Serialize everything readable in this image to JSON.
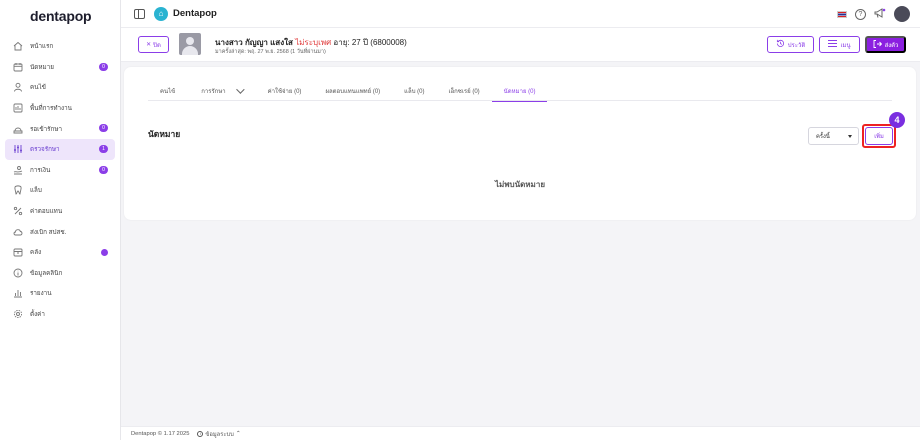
{
  "app": {
    "logo": "dentapop",
    "brand_name": "Dentapop"
  },
  "sidebar": {
    "items": [
      {
        "label": "หน้าแรก",
        "icon": "home-icon",
        "badge": ""
      },
      {
        "label": "นัดหมาย",
        "icon": "calendar-icon",
        "badge": "0"
      },
      {
        "label": "คนไข้",
        "icon": "user-icon",
        "badge": ""
      },
      {
        "label": "พื้นที่การทำงาน",
        "icon": "workspace-icon",
        "badge": ""
      },
      {
        "label": "รอเข้ารักษา",
        "icon": "waiting-icon",
        "badge": "0"
      },
      {
        "label": "ตรวจรักษา",
        "icon": "treatment-icon",
        "badge": "1"
      },
      {
        "label": "การเงิน",
        "icon": "finance-icon",
        "badge": "0"
      },
      {
        "label": "แล็บ",
        "icon": "tooth-icon",
        "badge": ""
      },
      {
        "label": "ค่าตอบแทน",
        "icon": "percent-icon",
        "badge": ""
      },
      {
        "label": "ส่งเบิก สปสช.",
        "icon": "cloud-icon",
        "badge": ""
      },
      {
        "label": "คลัง",
        "icon": "inventory-icon",
        "badge": "dot"
      },
      {
        "label": "ข้อมูลคลินิก",
        "icon": "info-icon",
        "badge": ""
      },
      {
        "label": "รายงาน",
        "icon": "report-icon",
        "badge": ""
      },
      {
        "label": "ตั้งค่า",
        "icon": "gear-icon",
        "badge": ""
      }
    ]
  },
  "patient": {
    "close_label": "ปิด",
    "name": "นางสาว กัญญา แสงใส",
    "gender": "ไม่ระบุเพศ",
    "age_text": "อายุ: 27 ปี",
    "hn": "(6800008)",
    "last_visit": "มาครั้งล่าสุด: พฤ. 27 พ.ย. 2568 (1 วันที่ผ่านมา)",
    "history_label": "ประวัติ",
    "menu_label": "เมนู",
    "send_label": "ส่งตัว"
  },
  "tabs": [
    {
      "label": "คนไข้"
    },
    {
      "label": "การรักษา"
    },
    {
      "label": "ค่าใช้จ่าย (0)"
    },
    {
      "label": "ผลตอบแทนแพทย์ (0)"
    },
    {
      "label": "แล็บ (0)"
    },
    {
      "label": "เอ็กซเรย์ (0)"
    },
    {
      "label": "นัดหมาย (0)"
    }
  ],
  "appointments": {
    "title": "นัดหมาย",
    "filter_value": "ครั้งนี้",
    "add_label": "เพิ่ม",
    "step_number": "4",
    "empty_text": "ไม่พบนัดหมาย"
  },
  "footer": {
    "copyright": "Dentapop © 1.17 2025",
    "info_label": "ข้อมูลระบบ"
  },
  "colors": {
    "accent": "#8b3ee8",
    "highlight": "#e22222",
    "active_bg": "#eee5fb"
  }
}
